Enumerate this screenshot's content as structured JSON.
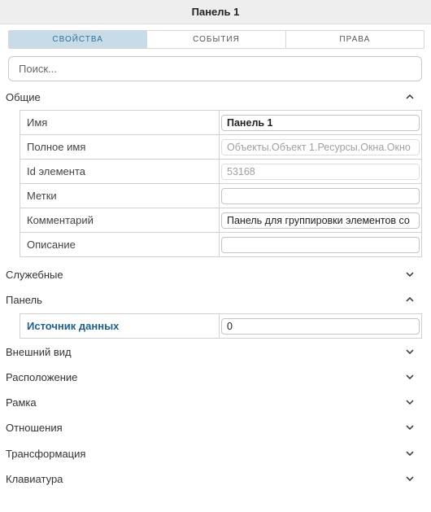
{
  "window": {
    "title": "Панель 1"
  },
  "tabs": [
    {
      "label": "СВОЙСТВА",
      "active": true
    },
    {
      "label": "СОБЫТИЯ",
      "active": false
    },
    {
      "label": "ПРАВА",
      "active": false
    }
  ],
  "search": {
    "placeholder": "Поиск..."
  },
  "sections": {
    "general": {
      "label": "Общие",
      "expanded": true,
      "properties": [
        {
          "name": "Имя",
          "value": "Панель 1"
        },
        {
          "name": "Полное имя",
          "value": "Объекты.Объект 1.Ресурсы.Окна.Окно"
        },
        {
          "name": "Id элемента",
          "value": "53168"
        },
        {
          "name": "Метки",
          "value": ""
        },
        {
          "name": "Комментарий",
          "value": "Панель для группировки элементов со"
        },
        {
          "name": "Описание",
          "value": ""
        }
      ]
    },
    "service": {
      "label": "Служебные",
      "expanded": false
    },
    "panel": {
      "label": "Панель",
      "expanded": true,
      "properties": [
        {
          "name": "Источник данных",
          "value": "0"
        }
      ]
    },
    "appearance": {
      "label": "Внешний вид",
      "expanded": false
    },
    "position": {
      "label": "Расположение",
      "expanded": false
    },
    "frame": {
      "label": "Рамка",
      "expanded": false
    },
    "relations": {
      "label": "Отношения",
      "expanded": false
    },
    "transform": {
      "label": "Трансформация",
      "expanded": false
    },
    "keyboard": {
      "label": "Клавиатура",
      "expanded": false
    }
  },
  "icons": {
    "expanded": "chevron-up-icon",
    "collapsed": "chevron-down-icon"
  },
  "colors": {
    "accent": "#2f6f98",
    "active_tab_bg": "#c8dce8",
    "highlight_label": "#1f5f8f"
  }
}
